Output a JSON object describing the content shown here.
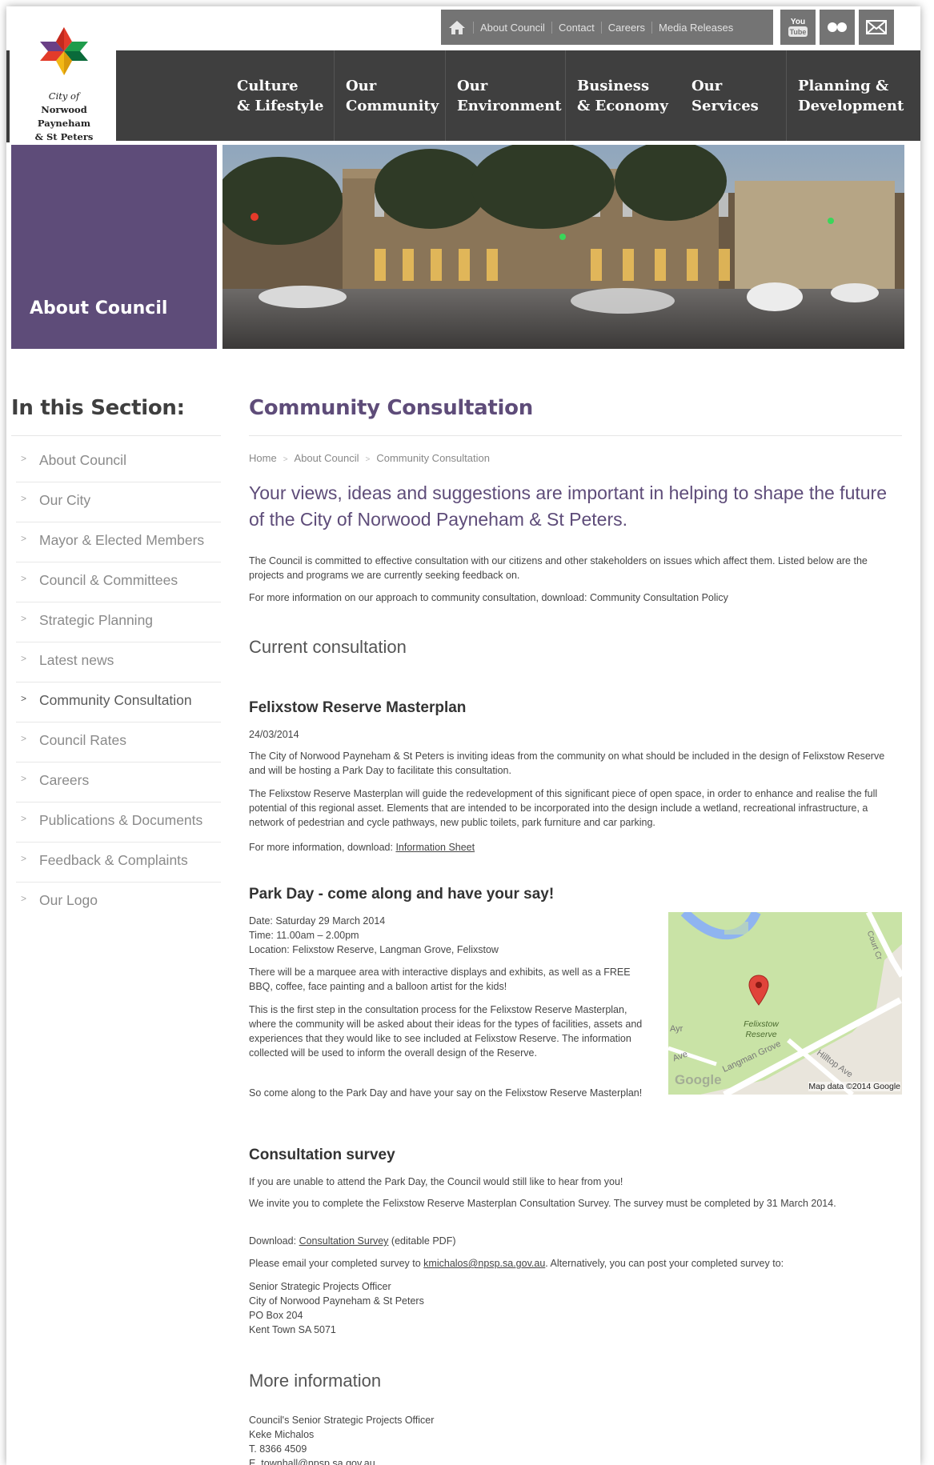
{
  "utility": {
    "links": [
      "About Council",
      "Contact",
      "Careers",
      "Media Releases"
    ],
    "youtube_label": "You Tube"
  },
  "logo": {
    "lines": [
      "City of",
      "Norwood",
      "Payneham",
      "& St Peters"
    ]
  },
  "nav": {
    "items": [
      "Culture\n& Lifestyle",
      "Our\nCommunity",
      "Our\nEnvironment",
      "Business\n& Economy",
      "Our\nServices",
      "Planning &\nDevelopment"
    ]
  },
  "banner": {
    "title": "About Council"
  },
  "sidebar": {
    "heading": "In this Section:",
    "items": [
      {
        "label": "About Council"
      },
      {
        "label": "Our City"
      },
      {
        "label": "Mayor & Elected Members"
      },
      {
        "label": "Council & Committees"
      },
      {
        "label": "Strategic Planning"
      },
      {
        "label": "Latest news"
      },
      {
        "label": "Community Consultation"
      },
      {
        "label": "Council Rates"
      },
      {
        "label": "Careers"
      },
      {
        "label": "Publications & Documents"
      },
      {
        "label": "Feedback & Complaints"
      },
      {
        "label": "Our Logo"
      }
    ]
  },
  "main": {
    "title": "Community Consultation",
    "breadcrumb": [
      "Home",
      "About Council",
      "Community Consultation"
    ],
    "lead": "Your views, ideas and suggestions are important in helping to shape the future of the City of Norwood Payneham & St Peters.",
    "intro": "The Council is committed to effective consultation with our citizens and other stakeholders on issues which affect them. Listed below are the projects and programs we are currently seeking feedback on.",
    "policy_prefix": "For more information on our approach to community consultation, download:",
    "policy_link": "Community Consultation Policy",
    "current_heading": "Current consultation",
    "felixstow": {
      "heading": "Felixstow Reserve Masterplan",
      "date": "24/03/2014",
      "p1": "The City of Norwood Payneham & St Peters is inviting ideas from the community on what should be included in the design of Felixstow Reserve and will be hosting a Park Day to facilitate this consultation.",
      "p2": "The Felixstow Reserve Masterplan will guide the redevelopment of this significant piece of open space, in order to enhance and realise the full potential of this regional asset. Elements that are intended to be incorporated into the design include a wetland, recreational infrastructure, a network of pedestrian and cycle pathways, new public toilets, park furniture and car parking.",
      "more_prefix": "For more information, download:",
      "more_link": "Information Sheet"
    },
    "park_day": {
      "heading": "Park Day - come along and have your say!",
      "date_line": "Date: Saturday 29 March 2014",
      "time_line": "Time: 11.00am – 2.00pm",
      "location_line": "Location: Felixstow Reserve, Langman Grove, Felixstow",
      "p1": "There will be a marquee area with interactive displays and exhibits, as well as a FREE BBQ, coffee, face painting and a balloon artist for the kids!",
      "p2": "This is the first step in the consultation process for the Felixstow Reserve Masterplan, where the community will be asked about their ideas for the types of facilities, assets and experiences that they would like to see included at Felixstow Reserve. The information collected will be used to inform the overall design of the Reserve.",
      "p3": "So come along to the Park Day and have your say on the Felixstow Reserve Masterplan!"
    },
    "map": {
      "place_label_1": "Felixstow",
      "place_label_2": "Reserve",
      "street_1": "Langman Grove",
      "street_2": "Hilltop Ave",
      "street_3": "Ave",
      "street_4": "Ayr",
      "street_5": "Court Cr",
      "google": "Google",
      "attribution": "Map data ©2014 Google"
    },
    "survey": {
      "heading": "Consultation survey",
      "p1": "If you are unable to attend the Park Day, the Council would still like to hear from you!",
      "p2": "We invite you to complete the Felixstow Reserve Masterplan Consultation Survey. The survey must be completed by 31 March 2014.",
      "download_prefix": "Download:",
      "download_link": "Consultation Survey",
      "download_suffix": "(editable PDF)",
      "email_prefix": "Please email your completed survey to",
      "email_link": "kmichalos@npsp.sa.gov.au",
      "email_suffix": ". Alternatively, you can post your completed survey to:",
      "address": [
        "Senior Strategic Projects Officer",
        "City of Norwood Payneham & St Peters",
        "PO Box 204",
        "Kent Town SA 5071"
      ]
    },
    "more_info": {
      "heading": "More information",
      "lines": [
        "Council's Senior Strategic Projects Officer",
        "Keke Michalos",
        "T. 8366 4509"
      ],
      "email_prefix": "E.",
      "email_link": "townhall@npsp.sa.gov.au"
    }
  },
  "colors": {
    "brand_purple": "#5e4c79",
    "nav_dark": "#3f3f3f",
    "utility_grey": "#747474",
    "map_green": "#c9e3a6",
    "map_water": "#8fb4f0"
  },
  "icons": [
    "home-icon",
    "youtube-icon",
    "flickr-icon",
    "email-icon",
    "chevron-right-icon",
    "map-pin-icon"
  ]
}
